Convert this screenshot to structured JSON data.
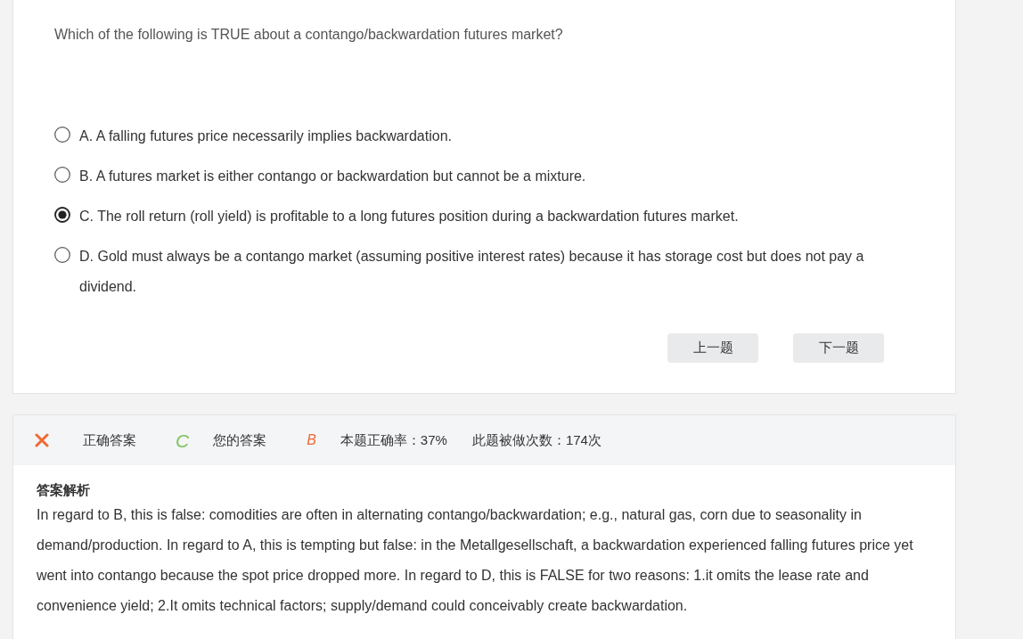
{
  "question": {
    "text": "Which of the following is TRUE about a contango/backwardation futures market?"
  },
  "options": [
    {
      "text": "A. A falling futures price necessarily implies backwardation.",
      "selected": false
    },
    {
      "text": "B. A futures market is either contango or backwardation but cannot be a mixture.",
      "selected": false
    },
    {
      "text": "C. The roll return (roll yield) is profitable to a long futures position during a backwardation futures market.",
      "selected": true
    },
    {
      "text": "D. Gold must always be a contango market (assuming positive interest rates) because it has storage cost but does not pay a dividend.",
      "selected": false
    }
  ],
  "nav_buttons": [
    "上一题",
    "下一题"
  ],
  "result_bar": {
    "correct": false,
    "correct_answer_label": "正确答案",
    "correct_answer": "C",
    "your_answer_label": "您的答案",
    "your_answer": "B",
    "accuracy": "本题正确率：37%",
    "attempts": "此题被做次数：174次"
  },
  "explanation": {
    "title": "答案解析",
    "text": "In regard to B, this is false: comodities are often in alternating contango/backwardation; e.g., natural gas, corn due to seasonality in demand/production. In regard to A, this is tempting but false: in the Metallgesellschaft, a backwardation experienced falling futures price yet went into contango because the spot price dropped more. In regard to D, this is FALSE for two reasons: 1.it omits the lease rate and convenience yield; 2.It omits technical factors; supply/demand could conceivably create backwardation."
  }
}
